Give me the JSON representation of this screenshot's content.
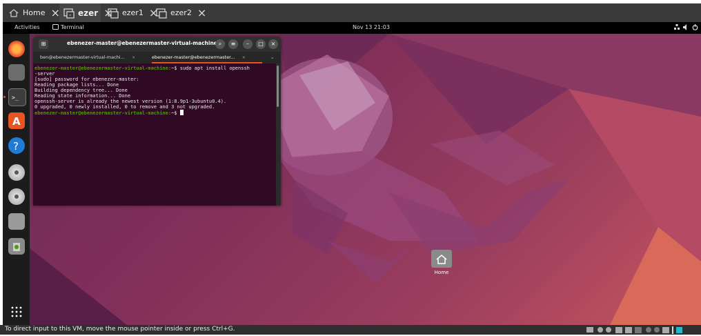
{
  "vm_tabs": [
    {
      "label": "Home",
      "icon": "home-icon"
    },
    {
      "label": "ezer",
      "icon": "vm-icon"
    },
    {
      "label": "ezer1",
      "icon": "vm-icon"
    },
    {
      "label": "ezer2",
      "icon": "vm-icon"
    }
  ],
  "topbar": {
    "activities": "Activities",
    "app_label": "Terminal",
    "clock": "Nov 13  21:03"
  },
  "terminal": {
    "title": "ebenezer-master@ebenezermaster-virtual-machine: ~",
    "tabs": [
      "ben@ebenezermaster-virtual-machi...",
      "ebenezer-master@ebenezermaster..."
    ],
    "prompt": "ebenezer-master@ebenezermaster-virtual-machine:",
    "prompt_suffix": "~$",
    "command": " sudo apt install openssh",
    "command_cont": "-server",
    "output": [
      "[sudo] password for ebenezer-master:",
      "Reading package lists... Done",
      "Building dependency tree... Done",
      "Reading state information... Done",
      "openssh-server is already the newest version (1:8.9p1-3ubuntu0.4).",
      "0 upgraded, 0 newly installed, 0 to remove and 3 not upgraded."
    ]
  },
  "desktop": {
    "home_label": "Home"
  },
  "statusbar": {
    "message": "To direct input to this VM, move the mouse pointer inside or press Ctrl+G."
  },
  "colors": {
    "accent": "#e95420",
    "terminal_bg": "#300a24",
    "prompt": "#4e9a06"
  }
}
